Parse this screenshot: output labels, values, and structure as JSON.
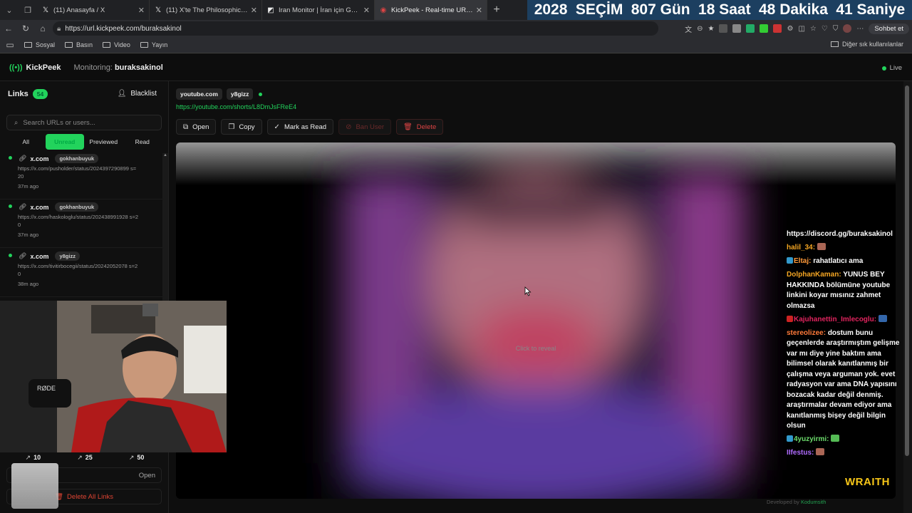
{
  "browser": {
    "tabs": [
      {
        "title": "(11) Anasayfa / X",
        "icon": "x-logo-icon"
      },
      {
        "title": "(11) X'te The Philosophical Investo",
        "icon": "x-logo-icon"
      },
      {
        "title": "Iran Monitor | İran için Gerçek Zam",
        "icon": "monitor-icon"
      },
      {
        "title": "KickPeek - Real-time URL Crawler f",
        "icon": "kickpeek-icon"
      }
    ],
    "countdown": {
      "year": "2028",
      "label": "SEÇİM",
      "days": "807 Gün",
      "hours": "18 Saat",
      "minutes": "48 Dakika",
      "seconds": "41 Saniye"
    },
    "address": "https://url.kickpeek.com/buraksakinol",
    "sohbet_label": "Sohbet et",
    "bookmarks": [
      "Sosyal",
      "Basın",
      "Video",
      "Yayın"
    ],
    "bookmarks_other": "Diğer sık kullanılanlar"
  },
  "app": {
    "name": "KickPeek",
    "monitoring_label": "Monitoring:",
    "channel": "buraksakinol",
    "live_label": "Live"
  },
  "sidebar": {
    "title": "Links",
    "count": "54",
    "blacklist_label": "Blacklist",
    "search_placeholder": "Search URLs or users...",
    "filters": [
      "All",
      "Unread",
      "Previewed",
      "Read"
    ],
    "active_filter": "Unread",
    "items": [
      {
        "domain": "x.com",
        "user": "gokhanbuyuk",
        "url": "https://x.com/pusholder/status/2024397290899 s=20",
        "ago": "37m ago"
      },
      {
        "domain": "x.com",
        "user": "gokhanbuyuk",
        "url": "https://x.com/haskologlu/status/202438991928 s=20",
        "ago": "37m ago"
      },
      {
        "domain": "x.com",
        "user": "y8gizz",
        "url": "https://x.com/tivitirbocegii/status/20242052078 s=20",
        "ago": "38m ago"
      }
    ],
    "stats": [
      "10",
      "25",
      "50"
    ],
    "open_label": "Open",
    "delete_all_label": "Delete All Links"
  },
  "detail": {
    "domain": "youtube.com",
    "user": "y8gizz",
    "url": "https://youtube.com/shorts/L8DmJsFReE4",
    "actions": {
      "open": "Open",
      "copy": "Copy",
      "mark_read": "Mark as Read",
      "ban": "Ban User",
      "delete": "Delete"
    },
    "reveal_label": "Click to reveal"
  },
  "chat": [
    {
      "user": "",
      "text": "https://discord.gg/buraksakinol"
    },
    {
      "user": "halil_34:",
      "text": ""
    },
    {
      "user": "Eltaj:",
      "text": "rahatlatıcı ama"
    },
    {
      "user": "DolphanKaman:",
      "text": "YUNUS BEY HAKKINDA bölümüne youtube linkini koyar mısınız zahmet olmazsa"
    },
    {
      "user": "Kajuhanettin_Imlecoglu:",
      "text": ""
    },
    {
      "user": "stereolizee:",
      "text": "dostum bunu geçenlerde araştırmıştım gelişme var mı diye yine baktım ama bilimsel olarak kanıtlanmış bir çalışma veya arguman yok. evet radyasyon var ama DNA yapısını bozacak kadar değil denmiş. araştırmalar devam ediyor ama kanıtlanmış bişey değil bilgin olsun"
    },
    {
      "user": "4yuzyirmi:",
      "text": ""
    },
    {
      "user": "IIfestus:",
      "text": ""
    }
  ],
  "overlay": {
    "brand": "WRAITH",
    "dev_prefix": "Developed by",
    "dev_name": "Kodumsith"
  },
  "colors": {
    "accent": "#22d35c",
    "danger": "#d44444",
    "countdown_bg": "#1c3f60"
  }
}
